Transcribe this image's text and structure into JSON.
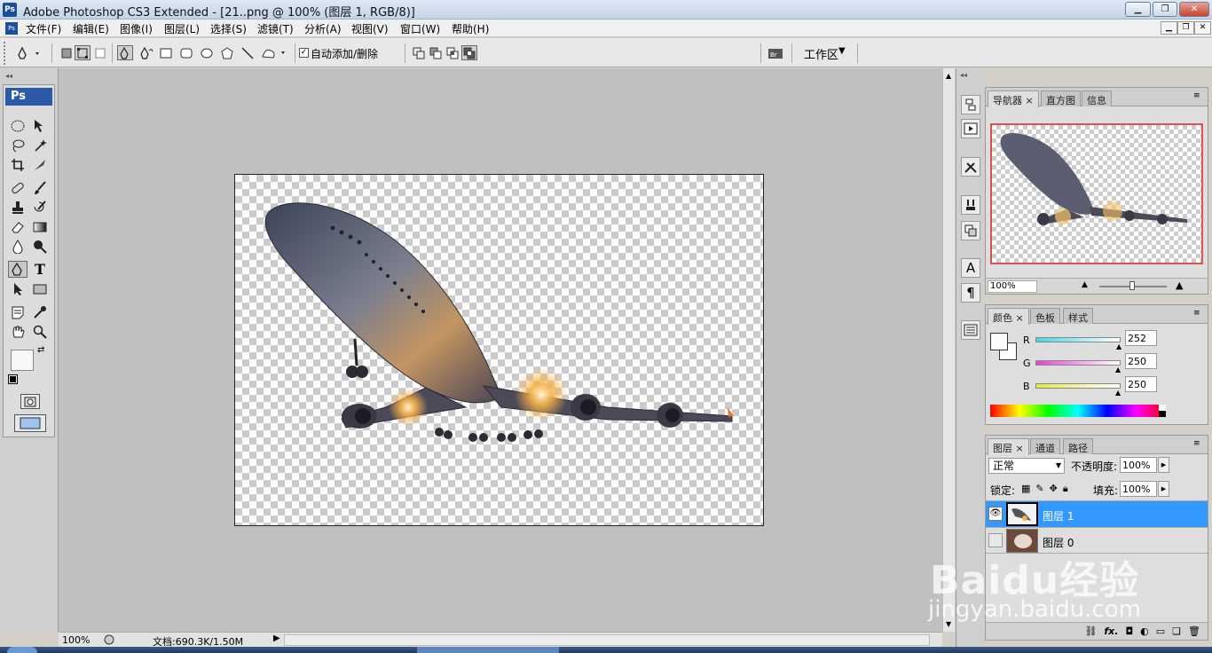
{
  "window": {
    "title": "Adobe Photoshop CS3 Extended - [21..png @ 100% (图层 1, RGB/8)]",
    "app_icon": "Ps",
    "buttons": [
      "minimize",
      "maximize",
      "close"
    ]
  },
  "menu": {
    "items": [
      "文件(F)",
      "编辑(E)",
      "图像(I)",
      "图层(L)",
      "选择(S)",
      "滤镜(T)",
      "分析(A)",
      "视图(V)",
      "窗口(W)",
      "帮助(H)"
    ]
  },
  "options_bar": {
    "auto_add_delete_label": "自动添加/删除",
    "auto_add_delete_checked": true,
    "workspace_label": "工作区"
  },
  "toolbox": {
    "header": "Ps"
  },
  "status_bar": {
    "zoom": "100%",
    "doc_info": "文档:690.3K/1.50M"
  },
  "navigator": {
    "tabs": [
      "导航器",
      "直方图",
      "信息"
    ],
    "zoom": "100%"
  },
  "color_panel": {
    "tabs": [
      "颜色",
      "色板",
      "样式"
    ],
    "channels": [
      {
        "label": "R",
        "value": "252",
        "level": 0.988
      },
      {
        "label": "G",
        "value": "250",
        "level": 0.98
      },
      {
        "label": "B",
        "value": "250",
        "level": 0.98
      }
    ],
    "colors": {
      "R": "#3fd6e8",
      "G": "#e83fd6",
      "B": "#e6e83f"
    }
  },
  "layers_panel": {
    "tabs": [
      "图层",
      "通道",
      "路径"
    ],
    "blend_mode": "正常",
    "opacity_label": "不透明度:",
    "opacity_value": "100%",
    "lock_label": "锁定:",
    "fill_label": "填充:",
    "fill_value": "100%",
    "layers": [
      {
        "name": "图层 1",
        "visible": true,
        "selected": true
      },
      {
        "name": "图层 0",
        "visible": false,
        "selected": false
      }
    ],
    "footer_icons": [
      "link-icon",
      "fx-icon",
      "mask-icon",
      "adjustment-icon",
      "group-icon",
      "new-layer-icon",
      "trash-icon"
    ]
  },
  "watermark": {
    "brand": "Baidu经验",
    "url": "jingyan.baidu.com"
  },
  "accent_colors": {
    "selection": "#3399ff",
    "navigator_frame": "#d9534f"
  }
}
